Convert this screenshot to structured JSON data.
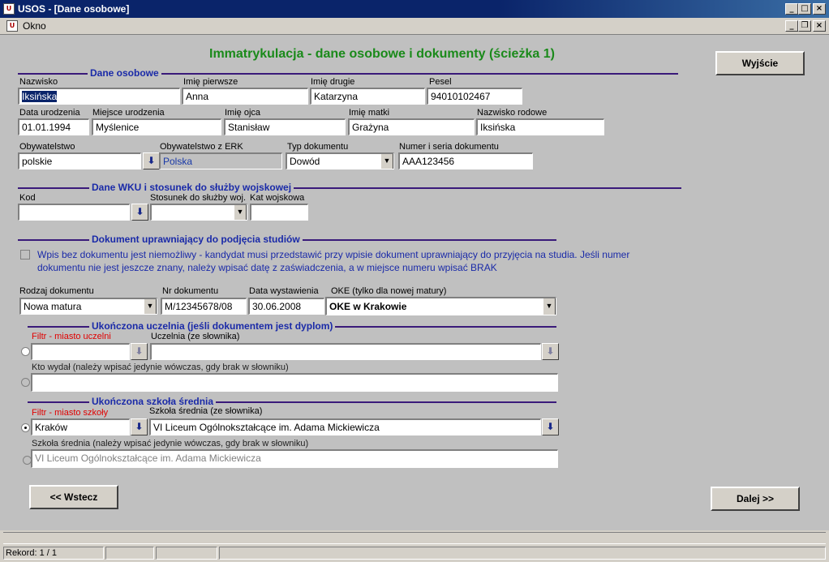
{
  "window": {
    "title": "USOS - [Dane osobowe]",
    "menu": "Okno"
  },
  "header": {
    "title": "Immatrykulacja - dane osobowe i dokumenty (ścieżka 1)",
    "exit_label": "Wyjście"
  },
  "personal": {
    "section_title": "Dane osobowe",
    "surname_label": "Nazwisko",
    "surname": "Iksińska",
    "first_name_label": "Imię pierwsze",
    "first_name": "Anna",
    "second_name_label": "Imię drugie",
    "second_name": "Katarzyna",
    "pesel_label": "Pesel",
    "pesel": "94010102467",
    "birth_date_label": "Data urodzenia",
    "birth_date": "01.01.1994",
    "birth_place_label": "Miejsce urodzenia",
    "birth_place": "Myślenice",
    "father_label": "Imię ojca",
    "father": "Stanisław",
    "mother_label": "Imię matki",
    "mother": "Grażyna",
    "family_name_label": "Nazwisko rodowe",
    "family_name": "Iksińska",
    "citizenship_label": "Obywatelstwo",
    "citizenship": "polskie",
    "citizenship_erk_label": "Obywatelstwo z ERK",
    "citizenship_erk": "Polska",
    "doc_type_label": "Typ dokumentu",
    "doc_type": "Dowód",
    "doc_number_label": "Numer i seria dokumentu",
    "doc_number": "AAA123456"
  },
  "military": {
    "section_title": "Dane WKU i stosunek do służby wojskowej",
    "code_label": "Kod",
    "code": "",
    "relation_label": "Stosunek do służby woj.",
    "relation": "",
    "category_label": "Kat wojskowa",
    "category": ""
  },
  "document": {
    "section_title": "Dokument uprawniający do podjęcia studiów",
    "note_line1": "Wpis bez dokumentu jest niemożliwy - kandydat musi przedstawić przy wpisie dokument uprawniający do przyjęcia na studia. Jeśli numer",
    "note_line2": "dokumentu nie jest jeszcze znany, należy wpisać datę z zaświadczenia, a w miejsce numeru wpisać BRAK",
    "type_label": "Rodzaj dokumentu",
    "type": "Nowa matura",
    "number_label": "Nr dokumentu",
    "number": "M/12345678/08",
    "issue_date_label": "Data wystawienia",
    "issue_date": "30.06.2008",
    "oke_label": "OKE (tylko dla nowej matury)",
    "oke": "OKE w Krakowie"
  },
  "university": {
    "section_title": "Ukończona uczelnia (jeśli dokumentem jest dyplom)",
    "city_filter_label": "Filtr - miasto uczelni",
    "city_filter": "",
    "university_label": "Uczelnia (ze słownika)",
    "university": "",
    "issuer_label": "Kto wydał (należy wpisać jedynie wówczas, gdy brak w słowniku)",
    "issuer": ""
  },
  "school": {
    "section_title": "Ukończona szkoła średnia",
    "city_filter_label": "Filtr - miasto szkoły",
    "city_filter": "Kraków",
    "school_label": "Szkoła średnia (ze słownika)",
    "school": "VI Liceum Ogólnokształcące im. Adama Mickiewicza",
    "school_manual_label": "Szkoła średnia (należy wpisać jedynie wówczas, gdy brak w słowniku)",
    "school_manual": "VI Liceum Ogólnokształcące im. Adama Mickiewicza"
  },
  "nav": {
    "back_label": "<< Wstecz",
    "next_label": "Dalej >>"
  },
  "status": {
    "record": "Rekord: 1 / 1"
  },
  "colors": {
    "title_green": "#1a8a1a",
    "section_blue": "#1a2aa8",
    "filter_red": "#e00000"
  }
}
